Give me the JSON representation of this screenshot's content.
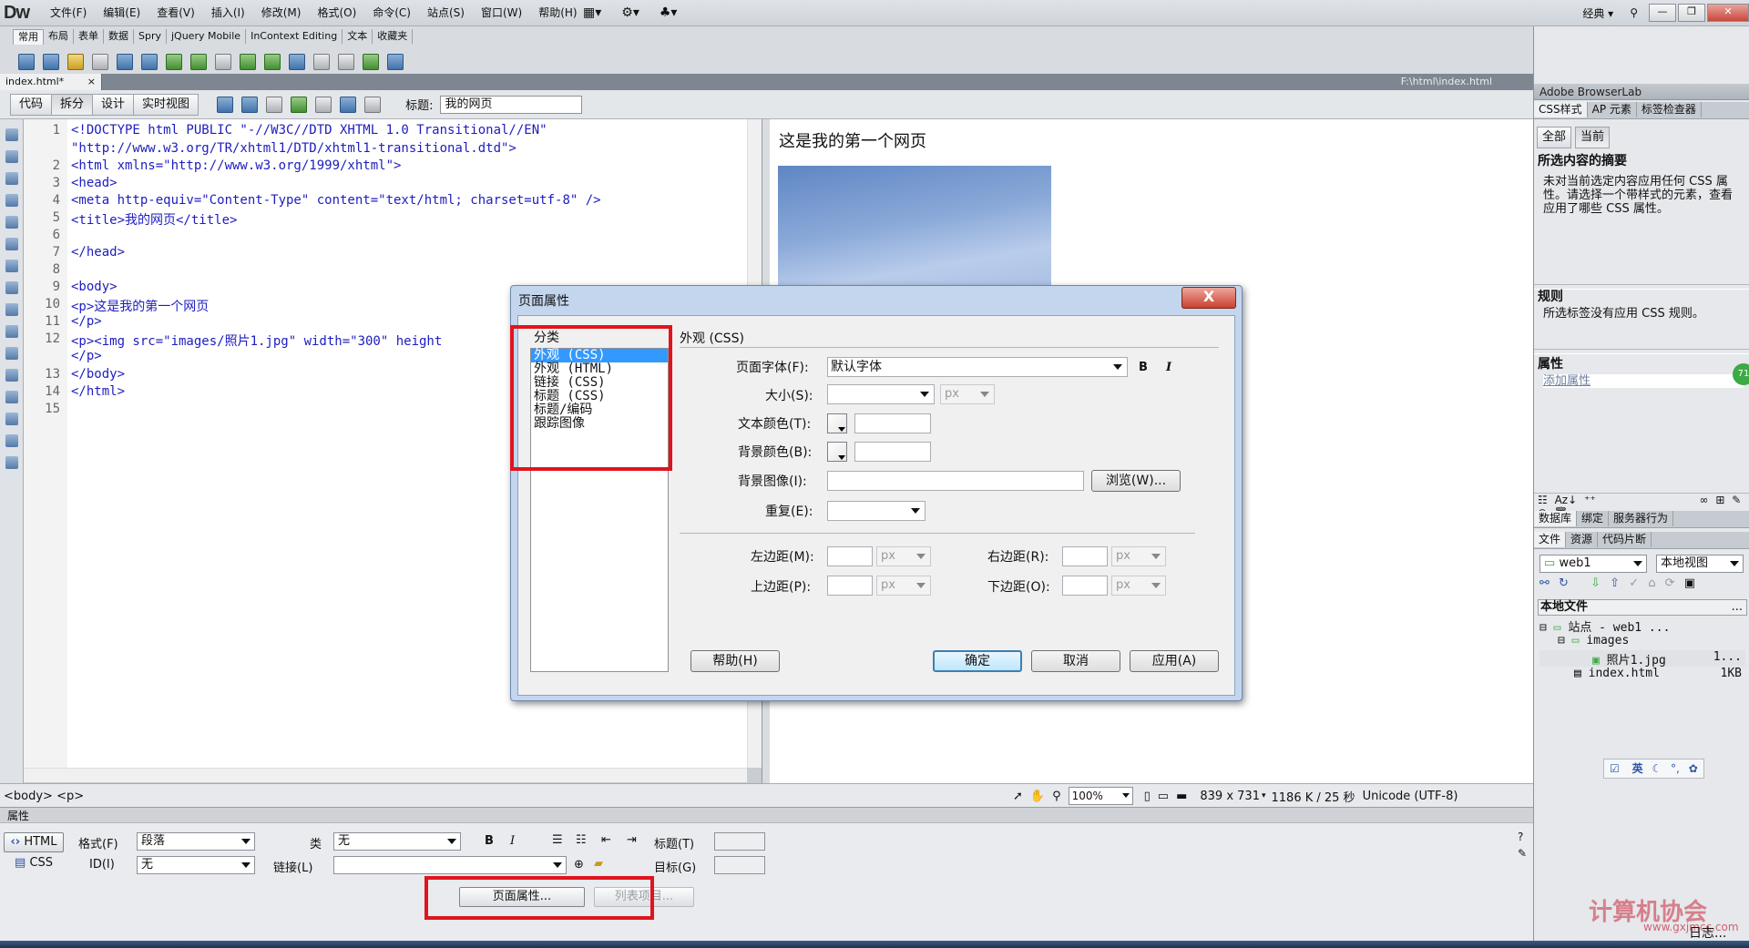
{
  "app": {
    "logo": "Dw",
    "menus": [
      "文件(F)",
      "编辑(E)",
      "查看(V)",
      "插入(I)",
      "修改(M)",
      "格式(O)",
      "命令(C)",
      "站点(S)",
      "窗口(W)",
      "帮助(H)"
    ],
    "workspace": "经典"
  },
  "insert_bar": {
    "tabs": [
      "常用",
      "布局",
      "表单",
      "数据",
      "Spry",
      "jQuery Mobile",
      "InContext Editing",
      "文本",
      "收藏夹"
    ]
  },
  "document": {
    "tab": "index.html*",
    "tab_close": "×",
    "path": "F:\\html\\index.html",
    "views": [
      "代码",
      "拆分",
      "设计",
      "实时视图"
    ],
    "title_label": "标题:",
    "title_value": "我的网页"
  },
  "code": {
    "line_numbers": [
      "1",
      "",
      "2",
      "3",
      "4",
      "5",
      "6",
      "7",
      "8",
      "9",
      "10",
      "11",
      "12",
      "",
      "13",
      "14",
      "15"
    ],
    "lines": [
      "<!DOCTYPE html PUBLIC \"-//W3C//DTD XHTML 1.0 Transitional//EN\"",
      "\"http://www.w3.org/TR/xhtml1/DTD/xhtml1-transitional.dtd\">",
      "<html xmlns=\"http://www.w3.org/1999/xhtml\">",
      "<head>",
      "<meta http-equiv=\"Content-Type\" content=\"text/html; charset=utf-8\" />",
      "<title>我的网页</title>",
      "",
      "</head>",
      "",
      "<body>",
      "<p>这是我的第一个网页",
      "</p>",
      "<p><img src=\"images/照片1.jpg\" width=\"300\" height",
      "</p>",
      "</body>",
      "</html>",
      ""
    ]
  },
  "design": {
    "paragraph": "这是我的第一个网页"
  },
  "status": {
    "tag_path": "<body> <p>",
    "zoom": "100%",
    "dimensions": "839 x 731",
    "size_time": "1186 K / 25 秒",
    "encoding": "Unicode (UTF-8)"
  },
  "properties": {
    "header": "属性",
    "html_btn": "HTML",
    "css_btn": "CSS",
    "format_label": "格式(F)",
    "format_value": "段落",
    "class_label": "类",
    "class_value": "无",
    "id_label": "ID(I)",
    "id_value": "无",
    "link_label": "链接(L)",
    "link_value": "",
    "title_label": "标题(T)",
    "target_label": "目标(G)",
    "page_props_btn": "页面属性...",
    "list_item_btn": "列表项目..."
  },
  "right_panel": {
    "browserlab": "Adobe BrowserLab",
    "css_tabs": [
      "CSS样式",
      "AP 元素",
      "标签检查器"
    ],
    "mode_buttons": [
      "全部",
      "当前"
    ],
    "summary_title": "所选内容的摘要",
    "summary_text": "未对当前选定内容应用任何 CSS 属性。请选择一个带样式的元素，查看应用了哪些 CSS 属性。",
    "rules_title": "规则",
    "rules_text": "所选标签没有应用 CSS 规则。",
    "props_title": "属性",
    "add_prop": "添加属性",
    "db_tabs": [
      "数据库",
      "绑定",
      "服务器行为"
    ],
    "file_tabs": [
      "文件",
      "资源",
      "代码片断"
    ],
    "site_select": "web1",
    "view_select": "本地视图",
    "local_files": "本地文件",
    "tree": [
      {
        "name": "站点 - web1 ...",
        "size": ""
      },
      {
        "name": "images",
        "size": ""
      },
      {
        "name": "照片1.jpg",
        "size": "1..."
      },
      {
        "name": "index.html",
        "size": "1KB"
      }
    ],
    "ime": "英",
    "log": "日志...",
    "watermark": "计算机协会",
    "watermark_url": "www.gxjmcc.com"
  },
  "dialog": {
    "title": "页面属性",
    "close": "X",
    "category_label": "分类",
    "categories": [
      "外观 (CSS)",
      "外观 (HTML)",
      "链接 (CSS)",
      "标题 (CSS)",
      "标题/编码",
      "跟踪图像"
    ],
    "section_title": "外观 (CSS)",
    "font_label": "页面字体(F):",
    "font_value": "默认字体",
    "bold": "B",
    "italic": "I",
    "size_label": "大小(S):",
    "size_unit": "px",
    "text_color_label": "文本颜色(T):",
    "bg_color_label": "背景颜色(B):",
    "bg_image_label": "背景图像(I):",
    "browse_btn": "浏览(W)...",
    "repeat_label": "重复(E):",
    "left_margin_label": "左边距(M):",
    "right_margin_label": "右边距(R):",
    "top_margin_label": "上边距(P):",
    "bottom_margin_label": "下边距(O):",
    "unit": "px",
    "help_btn": "帮助(H)",
    "ok_btn": "确定",
    "cancel_btn": "取消",
    "apply_btn": "应用(A)"
  },
  "colors": {
    "highlight_box": "#e0141d",
    "selection": "#3399ff",
    "code_tag": "#1d1dbf"
  }
}
